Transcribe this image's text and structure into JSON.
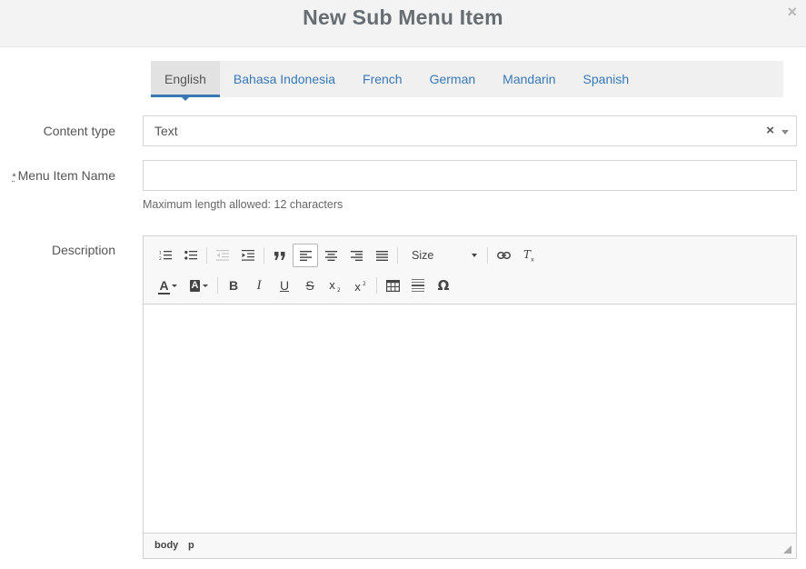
{
  "modal": {
    "title": "New Sub Menu Item",
    "close_label": "×"
  },
  "tabs": [
    {
      "label": "English",
      "active": true
    },
    {
      "label": "Bahasa Indonesia",
      "active": false
    },
    {
      "label": "French",
      "active": false
    },
    {
      "label": "German",
      "active": false
    },
    {
      "label": "Mandarin",
      "active": false
    },
    {
      "label": "Spanish",
      "active": false
    }
  ],
  "form": {
    "content_type": {
      "label": "Content type",
      "value": "Text",
      "clear": "×"
    },
    "menu_item_name": {
      "required_mark": "*",
      "label": "Menu Item Name",
      "value": "",
      "placeholder": "",
      "help": "Maximum length allowed: 12 characters"
    },
    "description": {
      "label": "Description"
    }
  },
  "editor": {
    "size_label": "Size",
    "text_color_glyph": "A",
    "bg_color_glyph": "A",
    "bold": "B",
    "italic": "I",
    "underline": "U",
    "strike": "S",
    "omega": "Ω",
    "path": [
      "body",
      "p"
    ]
  },
  "colors": {
    "accent": "#3a78b4",
    "header_bg": "#f3f3f3",
    "title": "#666d73"
  }
}
